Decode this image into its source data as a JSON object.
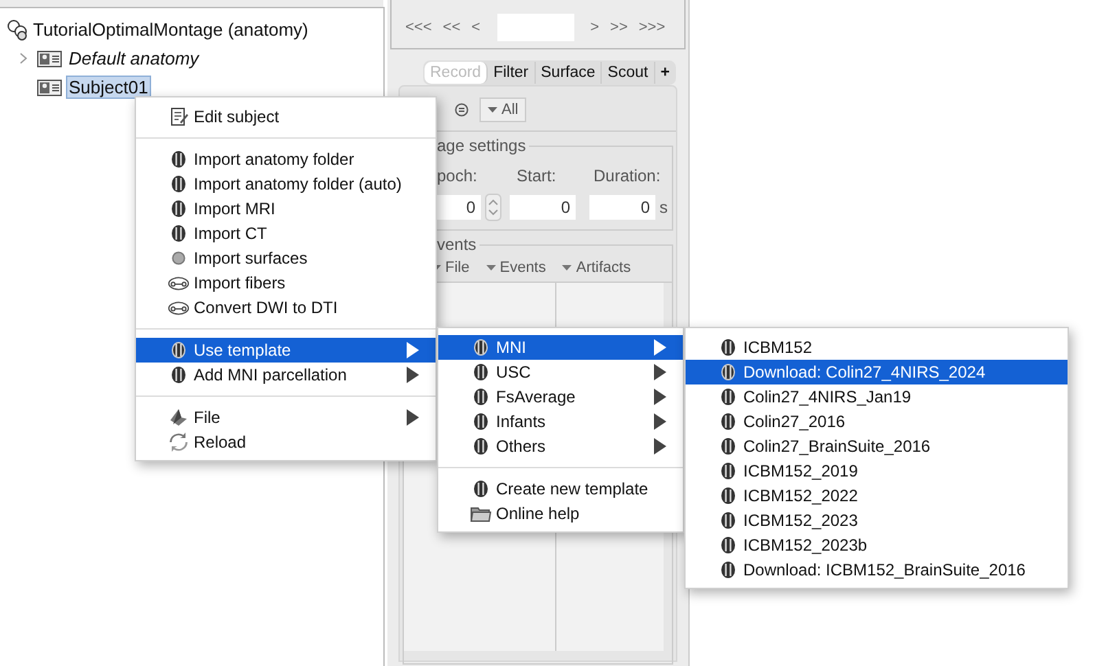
{
  "tree": {
    "label": "TutorialOptimalMontage (anatomy)",
    "children": [
      {
        "label": "Default anatomy",
        "default": true,
        "expanded": false,
        "selected": false
      },
      {
        "label": "Subject01",
        "default": false,
        "selected": true
      }
    ]
  },
  "navigation": {
    "back_buttons": [
      "<<<",
      "<<",
      "<"
    ],
    "forward_buttons": [
      ">",
      ">>",
      ">>>"
    ]
  },
  "tabs": [
    {
      "label": "Record",
      "selected": true
    },
    {
      "label": "Filter",
      "selected": false
    },
    {
      "label": "Surface",
      "selected": false
    },
    {
      "label": "Scout",
      "selected": false
    },
    {
      "label": "+",
      "selected": false
    }
  ],
  "toolbar": {
    "dropdown": "All"
  },
  "page_settings": {
    "title": "age settings",
    "fields": [
      {
        "label": "poch:",
        "value": "0",
        "kind": "spinner"
      },
      {
        "label": "Start:",
        "value": "0",
        "kind": "text"
      },
      {
        "label": "Duration:",
        "value": "0",
        "kind": "text"
      }
    ],
    "unit": "s"
  },
  "events": {
    "title": "vents",
    "menus": [
      "File",
      "Events",
      "Artifacts"
    ]
  },
  "context_menu": [
    {
      "kind": "edit",
      "label": "Edit subject",
      "submenu": false,
      "selected": false
    },
    {
      "kind": "separator"
    },
    {
      "kind": "brain",
      "label": "Import anatomy folder",
      "submenu": false,
      "selected": false
    },
    {
      "kind": "brain",
      "label": "Import anatomy folder (auto)",
      "submenu": false,
      "selected": false
    },
    {
      "kind": "brain",
      "label": "Import MRI",
      "submenu": false,
      "selected": false
    },
    {
      "kind": "brain",
      "label": "Import CT",
      "submenu": false,
      "selected": false
    },
    {
      "kind": "sphere",
      "label": "Import surfaces",
      "submenu": false,
      "selected": false
    },
    {
      "kind": "fibers",
      "label": "Import fibers",
      "submenu": false,
      "selected": false
    },
    {
      "kind": "fibers",
      "label": "Convert DWI to DTI",
      "submenu": false,
      "selected": false
    },
    {
      "kind": "separator"
    },
    {
      "kind": "brain",
      "label": "Use template",
      "submenu": true,
      "selected": true
    },
    {
      "kind": "brain",
      "label": "Add MNI parcellation",
      "submenu": true,
      "selected": false
    },
    {
      "kind": "separator"
    },
    {
      "kind": "file",
      "label": "File",
      "submenu": true,
      "selected": false
    },
    {
      "kind": "reload",
      "label": "Reload",
      "submenu": false,
      "selected": false
    }
  ],
  "template_menu": [
    {
      "kind": "brain",
      "label": "MNI",
      "submenu": true,
      "selected": true
    },
    {
      "kind": "brain",
      "label": "USC",
      "submenu": true,
      "selected": false
    },
    {
      "kind": "brain",
      "label": "FsAverage",
      "submenu": true,
      "selected": false
    },
    {
      "kind": "brain",
      "label": "Infants",
      "submenu": true,
      "selected": false
    },
    {
      "kind": "brain",
      "label": "Others",
      "submenu": true,
      "selected": false
    },
    {
      "kind": "separator"
    },
    {
      "kind": "brain",
      "label": "Create new template",
      "submenu": false,
      "selected": false
    },
    {
      "kind": "help",
      "label": "Online help",
      "submenu": false,
      "selected": false
    }
  ],
  "mni_menu": [
    {
      "kind": "brain",
      "label": "ICBM152",
      "submenu": false,
      "selected": false
    },
    {
      "kind": "brain",
      "label": "Download: Colin27_4NIRS_2024",
      "submenu": false,
      "selected": true
    },
    {
      "kind": "brain",
      "label": "Colin27_4NIRS_Jan19",
      "submenu": false,
      "selected": false
    },
    {
      "kind": "brain",
      "label": "Colin27_2016",
      "submenu": false,
      "selected": false
    },
    {
      "kind": "brain",
      "label": "Colin27_BrainSuite_2016",
      "submenu": false,
      "selected": false
    },
    {
      "kind": "brain",
      "label": "ICBM152_2019",
      "submenu": false,
      "selected": false
    },
    {
      "kind": "brain",
      "label": "ICBM152_2022",
      "submenu": false,
      "selected": false
    },
    {
      "kind": "brain",
      "label": "ICBM152_2023",
      "submenu": false,
      "selected": false
    },
    {
      "kind": "brain",
      "label": "ICBM152_2023b",
      "submenu": false,
      "selected": false
    },
    {
      "kind": "brain",
      "label": "Download: ICBM152_BrainSuite_2016",
      "submenu": false,
      "selected": false
    }
  ]
}
